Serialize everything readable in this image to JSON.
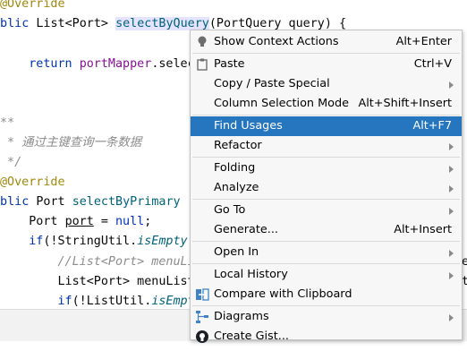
{
  "editor": {
    "lines": [
      {
        "parts": [
          {
            "t": "@Override",
            "c": "annotation"
          }
        ]
      },
      {
        "parts": [
          {
            "t": "ublic ",
            "c": "kw"
          },
          {
            "t": "List<Port> "
          },
          {
            "t": "selectByQuery",
            "c": "method ident-hl"
          },
          {
            "t": "(PortQuery query) {"
          }
        ]
      },
      {
        "parts": [
          {
            "t": ""
          }
        ]
      },
      {
        "parts": [
          {
            "t": "    "
          },
          {
            "t": "return ",
            "c": "kw"
          },
          {
            "t": "portMapper",
            "c": "ivar"
          },
          {
            "t": ".selec"
          }
        ]
      },
      {
        "parts": [
          {
            "t": ""
          }
        ]
      },
      {
        "parts": [
          {
            "t": ""
          }
        ]
      },
      {
        "parts": [
          {
            "t": "/**",
            "c": "comment"
          }
        ]
      },
      {
        "parts": [
          {
            "t": " * 通过主键查询一条数据",
            "c": "comment"
          }
        ]
      },
      {
        "parts": [
          {
            "t": " */",
            "c": "comment"
          }
        ]
      },
      {
        "parts": [
          {
            "t": "@Override",
            "c": "annotation"
          }
        ]
      },
      {
        "parts": [
          {
            "t": "ublic ",
            "c": "kw"
          },
          {
            "t": "Port "
          },
          {
            "t": "selectByPrimary",
            "c": "method"
          }
        ]
      },
      {
        "parts": [
          {
            "t": "    Port "
          },
          {
            "t": "port",
            "c": "local-underline"
          },
          {
            "t": " = "
          },
          {
            "t": "null",
            "c": "kw"
          },
          {
            "t": ";"
          }
        ]
      },
      {
        "parts": [
          {
            "t": "    "
          },
          {
            "t": "if",
            "c": "kw"
          },
          {
            "t": "(!StringUtil."
          },
          {
            "t": "isEmpty",
            "c": "static-call"
          },
          {
            "t": "("
          }
        ]
      },
      {
        "parts": [
          {
            "t": "        "
          },
          {
            "t": "//List<Port> menuLi",
            "c": "comment"
          }
        ]
      },
      {
        "parts": [
          {
            "t": "        List<Port> menuList"
          }
        ]
      },
      {
        "parts": [
          {
            "t": "        "
          },
          {
            "t": "if",
            "c": "kw"
          },
          {
            "t": "(!ListUtil."
          },
          {
            "t": "isEmpt",
            "c": "static-call"
          }
        ]
      }
    ],
    "right_edge_fragments": [
      "e",
      "t"
    ]
  },
  "context_menu": {
    "items": [
      {
        "name": "show-context-actions",
        "label": "Show Context Actions",
        "shortcut": "Alt+Enter",
        "icon": "lightbulb-icon"
      },
      {
        "sep": true
      },
      {
        "name": "paste",
        "label": "Paste",
        "shortcut": "Ctrl+V",
        "icon": "clipboard-icon"
      },
      {
        "name": "copy-paste-special",
        "label": "Copy / Paste Special",
        "submenu": true
      },
      {
        "name": "column-selection-mode",
        "label": "Column Selection Mode",
        "shortcut": "Alt+Shift+Insert"
      },
      {
        "sep": true
      },
      {
        "name": "find-usages",
        "label": "Find Usages",
        "shortcut": "Alt+F7",
        "selected": true
      },
      {
        "name": "refactor",
        "label": "Refactor",
        "submenu": true
      },
      {
        "sep": true
      },
      {
        "name": "folding",
        "label": "Folding",
        "submenu": true
      },
      {
        "name": "analyze",
        "label": "Analyze",
        "submenu": true
      },
      {
        "sep": true
      },
      {
        "name": "go-to",
        "label": "Go To",
        "submenu": true
      },
      {
        "name": "generate",
        "label": "Generate...",
        "shortcut": "Alt+Insert"
      },
      {
        "sep": true
      },
      {
        "name": "open-in",
        "label": "Open In",
        "submenu": true
      },
      {
        "sep": true
      },
      {
        "name": "local-history",
        "label": "Local History",
        "submenu": true
      },
      {
        "name": "compare-with-clipboard",
        "label": "Compare with Clipboard",
        "icon": "compare-icon"
      },
      {
        "sep": true
      },
      {
        "name": "diagrams",
        "label": "Diagrams",
        "submenu": true,
        "icon": "diagram-icon"
      },
      {
        "name": "create-gist",
        "label": "Create Gist...",
        "icon": "github-icon"
      }
    ],
    "colors": {
      "selected_bg": "#2675bf",
      "selected_fg": "#ffffff"
    }
  }
}
